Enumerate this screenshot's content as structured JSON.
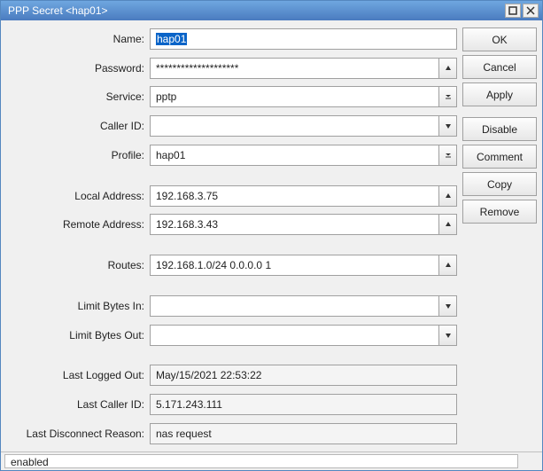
{
  "window": {
    "title": "PPP Secret <hap01>"
  },
  "fields": {
    "name": {
      "label": "Name:",
      "value": "hap01"
    },
    "password": {
      "label": "Password:",
      "value": "********************"
    },
    "service": {
      "label": "Service:",
      "value": "pptp"
    },
    "caller_id": {
      "label": "Caller ID:",
      "value": ""
    },
    "profile": {
      "label": "Profile:",
      "value": "hap01"
    },
    "local_address": {
      "label": "Local Address:",
      "value": "192.168.3.75"
    },
    "remote_address": {
      "label": "Remote Address:",
      "value": "192.168.3.43"
    },
    "routes": {
      "label": "Routes:",
      "value": "192.168.1.0/24 0.0.0.0 1"
    },
    "limit_bytes_in": {
      "label": "Limit Bytes In:",
      "value": ""
    },
    "limit_bytes_out": {
      "label": "Limit Bytes Out:",
      "value": ""
    },
    "last_logged_out": {
      "label": "Last Logged Out:",
      "value": "May/15/2021 22:53:22"
    },
    "last_caller_id": {
      "label": "Last Caller ID:",
      "value": "5.171.243.111"
    },
    "last_disconnect_reason": {
      "label": "Last Disconnect Reason:",
      "value": "nas request"
    }
  },
  "buttons": {
    "ok": "OK",
    "cancel": "Cancel",
    "apply": "Apply",
    "disable": "Disable",
    "comment": "Comment",
    "copy": "Copy",
    "remove": "Remove"
  },
  "status": {
    "text": "enabled"
  }
}
